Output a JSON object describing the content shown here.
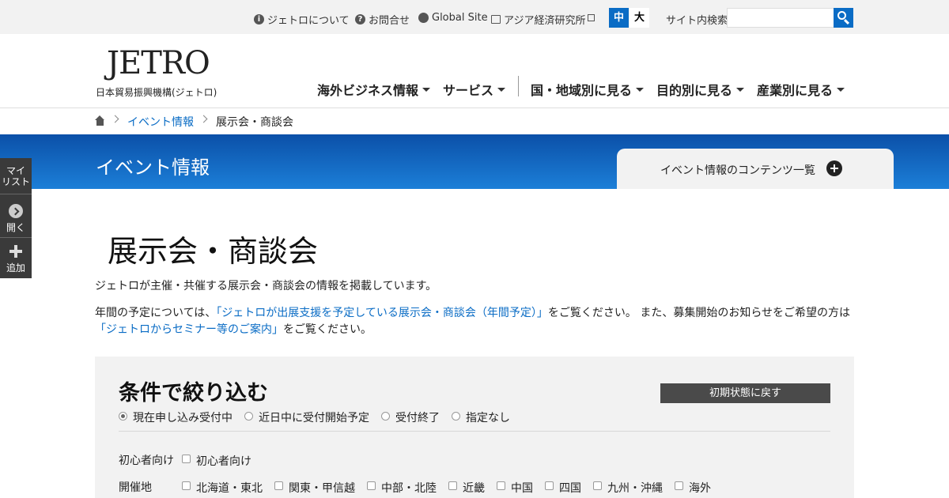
{
  "utility": {
    "about": "ジェトロについて",
    "contact": "お問合せ",
    "global": "Global Site",
    "ide": "アジア経済研究所",
    "size_mid": "中",
    "size_large": "大",
    "search_label": "サイト内検索",
    "search_placeholder": ""
  },
  "header": {
    "logo": "JETRO",
    "logo_sub": "日本貿易振興機構(ジェトロ)",
    "nav": [
      "海外ビジネス情報",
      "サービス",
      "国・地域別に見る",
      "目的別に見る",
      "産業別に見る"
    ]
  },
  "breadcrumb": {
    "parent": "イベント情報",
    "current": "展示会・商談会"
  },
  "band": {
    "title": "イベント情報",
    "contents_label": "イベント情報のコンテンツ一覧"
  },
  "mylist": {
    "title_line1": "マイ",
    "title_line2": "リスト",
    "open": "開く",
    "add": "追加"
  },
  "main": {
    "title": "展示会・商談会",
    "intro": "ジェトロが主催・共催する展示会・商談会の情報を掲載しています。",
    "para_a": "年間の予定については、",
    "link1": "「ジェトロが出展支援を予定している展示会・商談会（年間予定）」",
    "para_b": "をご覧ください。 また、募集開始のお知らせをご希望の方は",
    "link2": "「ジェトロからセミナー等のご案内」",
    "para_c": "をご覧ください。"
  },
  "filter": {
    "title": "条件で絞り込む",
    "reset": "初期状態に戻す",
    "status_options": [
      "現在申し込み受付中",
      "近日中に受付開始予定",
      "受付終了",
      "指定なし"
    ],
    "status_selected": "現在申し込み受付中",
    "beginner_label": "初心者向け",
    "beginner_option": "初心者向け",
    "region_label": "開催地",
    "regions": [
      "北海道・東北",
      "関東・甲信越",
      "中部・北陸",
      "近畿",
      "中国",
      "四国",
      "九州・沖縄",
      "海外"
    ]
  }
}
